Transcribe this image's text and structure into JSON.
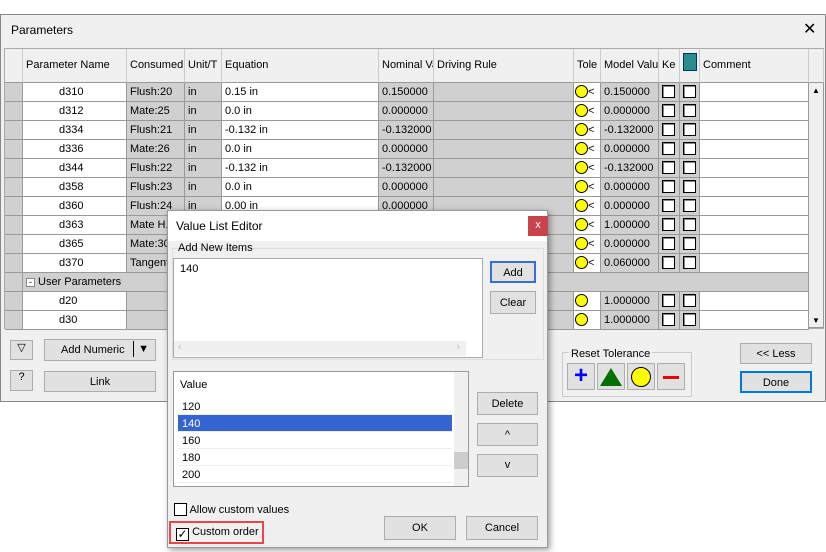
{
  "window": {
    "title": "Parameters",
    "close": "✕"
  },
  "columns": [
    "Parameter Name",
    "Consumed",
    "Unit/T",
    "Equation",
    "Nominal Va",
    "Driving Rule",
    "Tole",
    "Model Valu",
    "Ke",
    "",
    "Comment"
  ],
  "rows": [
    {
      "name": "d310",
      "consumed": "Flush:20",
      "unit": "in",
      "equation": "0.15 in",
      "nominal": "0.150000",
      "tol": "<",
      "model": "0.150000"
    },
    {
      "name": "d312",
      "consumed": "Mate:25",
      "unit": "in",
      "equation": "0.0 in",
      "nominal": "0.000000",
      "tol": "<",
      "model": "0.000000"
    },
    {
      "name": "d334",
      "consumed": "Flush:21",
      "unit": "in",
      "equation": "-0.132 in",
      "nominal": "-0.132000",
      "tol": "<",
      "model": "-0.132000"
    },
    {
      "name": "d336",
      "consumed": "Mate:26",
      "unit": "in",
      "equation": "0.0 in",
      "nominal": "0.000000",
      "tol": "<",
      "model": "0.000000"
    },
    {
      "name": "d344",
      "consumed": "Flush:22",
      "unit": "in",
      "equation": "-0.132 in",
      "nominal": "-0.132000",
      "tol": "<",
      "model": "-0.132000"
    },
    {
      "name": "d358",
      "consumed": "Flush:23",
      "unit": "in",
      "equation": "0.0 in",
      "nominal": "0.000000",
      "tol": "<",
      "model": "0.000000"
    },
    {
      "name": "d360",
      "consumed": "Flush:24",
      "unit": "in",
      "equation": "0.00 in",
      "nominal": "0.000000",
      "tol": "<",
      "model": "0.000000"
    },
    {
      "name": "d363",
      "consumed": "Mate H.",
      "unit": "",
      "equation": "",
      "nominal": "",
      "tol": "<",
      "model": "1.000000"
    },
    {
      "name": "d365",
      "consumed": "Mate:30",
      "unit": "",
      "equation": "",
      "nominal": "",
      "tol": "<",
      "model": "0.000000"
    },
    {
      "name": "d370",
      "consumed": "Tangent",
      "unit": "",
      "equation": "",
      "nominal": "",
      "tol": "<",
      "model": "0.060000"
    },
    {
      "group": "User Parameters"
    },
    {
      "name": "d20",
      "consumed": "",
      "unit": "",
      "equation": "",
      "nominal": "",
      "tol": "",
      "model": "1.000000"
    },
    {
      "name": "d30",
      "consumed": "",
      "unit": "",
      "equation": "",
      "nominal": "",
      "tol": "",
      "model": "1.000000"
    }
  ],
  "bottom": {
    "add_numeric": "Add Numeric",
    "link": "Link",
    "reset_tolerance": "Reset Tolerance",
    "less": "<< Less",
    "done": "Done"
  },
  "dialog": {
    "title": "Value List Editor",
    "close": "x",
    "add_new_items": "Add New Items",
    "new_items_value": "140",
    "add": "Add",
    "clear": "Clear",
    "value_header": "Value",
    "values": [
      "120",
      "140",
      "160",
      "180",
      "200"
    ],
    "selected": "140",
    "delete": "Delete",
    "up": "^",
    "down": "v",
    "allow_custom": "Allow custom values",
    "allow_custom_checked": false,
    "custom_order": "Custom order",
    "custom_order_checked": true,
    "ok": "OK",
    "cancel": "Cancel"
  },
  "colors": {
    "selection": "#3464d1",
    "highlight": "#e8464a",
    "tolerance_circle": "#ffff00",
    "focus": "#0078d7"
  }
}
